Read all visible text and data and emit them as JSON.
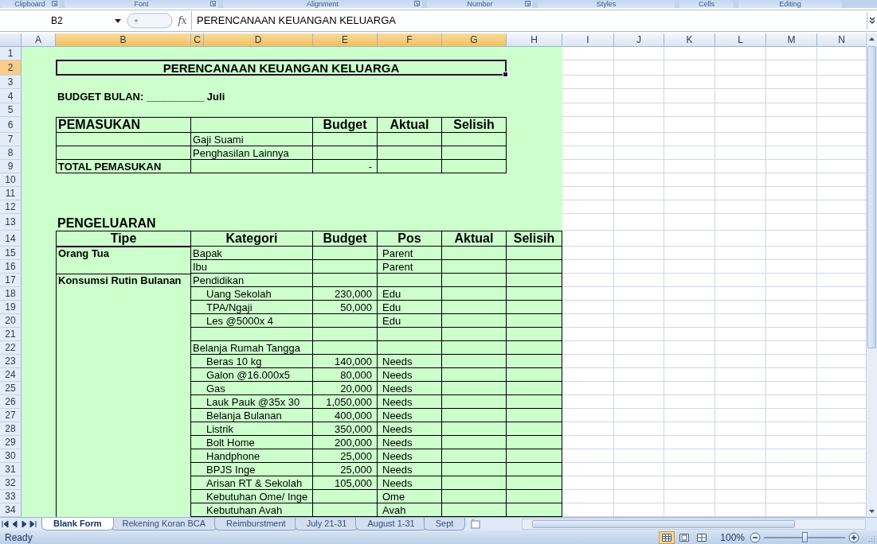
{
  "ribbon_groups": [
    {
      "label": "Clipboard",
      "launcher": true
    },
    {
      "label": "Font",
      "launcher": true
    },
    {
      "label": "Alignment",
      "launcher": true
    },
    {
      "label": "Number",
      "launcher": true
    },
    {
      "label": "Styles",
      "launcher": false
    },
    {
      "label": "Cells",
      "launcher": false
    },
    {
      "label": "Editing",
      "launcher": false
    }
  ],
  "formula_bar": {
    "name_box": "B2",
    "function_button": "fx",
    "formula": "PERENCANAAN KEUANGAN KELUARGA"
  },
  "columns": [
    {
      "label": "A",
      "selected": false
    },
    {
      "label": "B",
      "selected": true
    },
    {
      "label": "C",
      "selected": true
    },
    {
      "label": "D",
      "selected": true
    },
    {
      "label": "E",
      "selected": true
    },
    {
      "label": "F",
      "selected": true
    },
    {
      "label": "G",
      "selected": true
    },
    {
      "label": "H",
      "selected": false
    },
    {
      "label": "I",
      "selected": false
    },
    {
      "label": "J",
      "selected": false
    },
    {
      "label": "K",
      "selected": false
    },
    {
      "label": "L",
      "selected": false
    },
    {
      "label": "M",
      "selected": false
    },
    {
      "label": "N",
      "selected": false
    }
  ],
  "row_numbers": [
    {
      "label": "1",
      "selected": false
    },
    {
      "label": "2",
      "selected": true
    },
    {
      "label": "3",
      "selected": false
    },
    {
      "label": "4",
      "selected": false
    },
    {
      "label": "5",
      "selected": false
    },
    {
      "label": "6",
      "selected": false
    },
    {
      "label": "7",
      "selected": false
    },
    {
      "label": "8",
      "selected": false
    },
    {
      "label": "9",
      "selected": false
    },
    {
      "label": "10",
      "selected": false
    },
    {
      "label": "11",
      "selected": false
    },
    {
      "label": "12",
      "selected": false
    },
    {
      "label": "13",
      "selected": false
    },
    {
      "label": "14",
      "selected": false
    },
    {
      "label": "15",
      "selected": false
    },
    {
      "label": "16",
      "selected": false
    },
    {
      "label": "17",
      "selected": false
    },
    {
      "label": "18",
      "selected": false
    },
    {
      "label": "19",
      "selected": false
    },
    {
      "label": "20",
      "selected": false
    },
    {
      "label": "21",
      "selected": false
    },
    {
      "label": "22",
      "selected": false
    },
    {
      "label": "23",
      "selected": false
    },
    {
      "label": "24",
      "selected": false
    },
    {
      "label": "25",
      "selected": false
    },
    {
      "label": "26",
      "selected": false
    },
    {
      "label": "27",
      "selected": false
    },
    {
      "label": "28",
      "selected": false
    },
    {
      "label": "29",
      "selected": false
    },
    {
      "label": "30",
      "selected": false
    },
    {
      "label": "31",
      "selected": false
    },
    {
      "label": "32",
      "selected": false
    },
    {
      "label": "33",
      "selected": false
    },
    {
      "label": "34",
      "selected": false
    }
  ],
  "sheet": {
    "title": "PERENCANAAN KEUANGAN KELUARGA",
    "budget_month": "BUDGET BULAN: __________ Juli",
    "income": {
      "heading": "PEMASUKAN",
      "columns": [
        "Budget",
        "Aktual",
        "Selisih"
      ],
      "rows": [
        {
          "item": "Gaji Suami"
        },
        {
          "item": "Penghasilan Lainnya"
        }
      ],
      "total": {
        "label": "TOTAL PEMASUKAN",
        "budget": "-"
      }
    },
    "expenses": {
      "heading": "PENGELUARAN",
      "columns": [
        "Tipe",
        "Kategori",
        "Budget",
        "Pos",
        "Aktual",
        "Selisih"
      ],
      "groups": [
        {
          "type": "Orang Tua",
          "rows": [
            {
              "category": "Bapak",
              "pos": "Parent"
            },
            {
              "category": "Ibu",
              "pos": "Parent"
            }
          ]
        },
        {
          "type": "Konsumsi Rutin Bulanan",
          "rows": [
            {
              "category": "Pendidikan",
              "children": [
                {
                  "category": "Uang Sekolah",
                  "budget": "230,000",
                  "pos": "Edu"
                },
                {
                  "category": "TPA/Ngaji",
                  "budget": "50,000",
                  "pos": "Edu"
                },
                {
                  "category": "Les @5000x 4",
                  "pos": "Edu"
                }
              ]
            },
            {
              "category": "Belanja Rumah Tangga",
              "children": [
                {
                  "category": "Beras 10 kg",
                  "budget": "140,000",
                  "pos": "Needs"
                },
                {
                  "category": "Galon @16.000x5",
                  "budget": "80,000",
                  "pos": "Needs"
                },
                {
                  "category": "Gas",
                  "budget": "20,000",
                  "pos": "Needs"
                },
                {
                  "category": "Lauk Pauk @35x 30",
                  "budget": "1,050,000",
                  "pos": "Needs"
                },
                {
                  "category": "Belanja Bulanan",
                  "budget": "400,000",
                  "pos": "Needs"
                },
                {
                  "category": "Listrik",
                  "budget": "350,000",
                  "pos": "Needs"
                },
                {
                  "category": "Bolt Home",
                  "budget": "200,000",
                  "pos": "Needs"
                },
                {
                  "category": "Handphone",
                  "budget": "25,000",
                  "pos": "Needs"
                },
                {
                  "category": "BPJS Inge",
                  "budget": "25,000",
                  "pos": "Needs"
                },
                {
                  "category": "Arisan RT & Sekolah",
                  "budget": "105,000",
                  "pos": "Needs"
                },
                {
                  "category": "Kebutuhan Ome/ Inge",
                  "pos": "Ome"
                },
                {
                  "category": "Kebutuhan Avah",
                  "pos": "Avah"
                }
              ]
            }
          ]
        }
      ]
    }
  },
  "sheet_tabs": [
    {
      "label": "Blank Form",
      "selected": true
    },
    {
      "label": "Rekening Koran BCA",
      "selected": false
    },
    {
      "label": "Reimburstment",
      "selected": false
    },
    {
      "label": "July 21-31",
      "selected": false
    },
    {
      "label": "August 1-31",
      "selected": false
    },
    {
      "label": "Sept",
      "selected": false
    }
  ],
  "status_bar": {
    "status": "Ready",
    "views": [
      {
        "kind": "normal",
        "selected": true
      },
      {
        "kind": "layout",
        "selected": false
      },
      {
        "kind": "pagebreak",
        "selected": false
      }
    ],
    "zoom": "100%",
    "zoom_slider": {
      "level": 0.5
    }
  }
}
